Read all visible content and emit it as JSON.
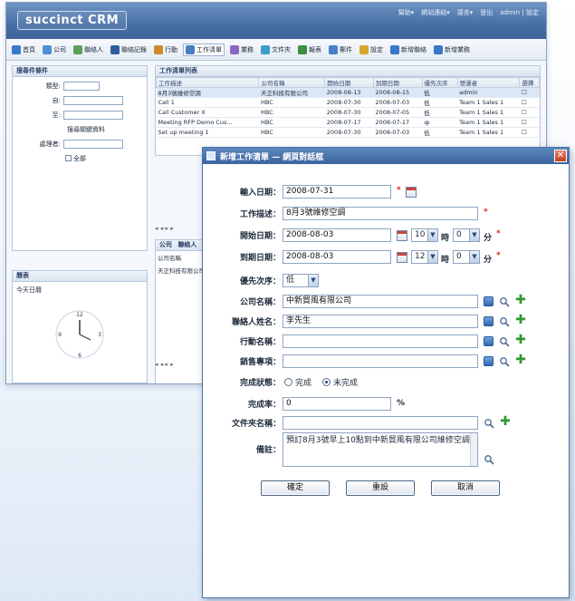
{
  "app": {
    "logo": "succinct CRM",
    "top_links": [
      "幫助▾",
      "網站連結▾",
      "語言▾",
      "登出",
      "admin | 設定"
    ]
  },
  "toolbar": {
    "items": [
      {
        "label": "首頁",
        "color": "#3a78c8"
      },
      {
        "label": "公司",
        "color": "#4f8fd4"
      },
      {
        "label": "聯絡人",
        "color": "#5aa05a"
      },
      {
        "label": "聯絡記錄",
        "color": "#2d5fa0"
      },
      {
        "label": "行動",
        "color": "#d08a2c"
      },
      {
        "label": "工作清單",
        "color": "#4a7fc0",
        "active": true
      },
      {
        "label": "業務",
        "color": "#8a6ac0"
      },
      {
        "label": "文件夾",
        "color": "#3aa0c8"
      },
      {
        "label": "報表",
        "color": "#3c8f3c"
      },
      {
        "label": "郵件",
        "color": "#4a80c8"
      },
      {
        "label": "設定",
        "color": "#d4a82c"
      },
      {
        "label": "新增聯絡",
        "color": "#3a78c8"
      },
      {
        "label": "新增業務",
        "color": "#3a78c8"
      }
    ]
  },
  "left_search": {
    "title": "搜尋件條件",
    "fields": [
      "類型:",
      "自:",
      "至:",
      "處理者:"
    ],
    "keyword_label": "搜尋關鍵資料",
    "checkbox_label": "全部"
  },
  "calendar_panel": {
    "title": "曆表",
    "today_label": "今天日曆"
  },
  "task_list": {
    "title": "工作清單列表",
    "columns": [
      "工作描述",
      "公司名稱",
      "開始日期",
      "到期日期",
      "優先次序",
      "營運者",
      "選擇"
    ],
    "rows": [
      {
        "cells": [
          "8月3號維修空調",
          "天正科技有限公司",
          "2008-08-13",
          "2008-08-15",
          "低",
          "admin",
          "☐"
        ],
        "selected": true
      },
      {
        "cells": [
          "Call 1",
          "HBC",
          "2008-07-30",
          "2008-07-03",
          "低",
          "Team 1 Sales 1",
          "☐"
        ],
        "selected": false
      },
      {
        "cells": [
          "Call Customer X",
          "HBC",
          "2008-07-30",
          "2008-07-05",
          "低",
          "Team 1 Sales 1",
          "☐"
        ],
        "selected": false
      },
      {
        "cells": [
          "Meeting RFP Demo Cus...",
          "HBC",
          "2008-07-17",
          "2008-07-17",
          "中",
          "Team 1 Sales 1",
          "☐"
        ],
        "selected": false
      },
      {
        "cells": [
          "Set up meeting 1",
          "HBC",
          "2008-07-30",
          "2008-07-03",
          "低",
          "Team 1 Sales 1",
          "☐"
        ],
        "selected": false
      }
    ],
    "pager": "◂ ◂ ▸ ▸"
  },
  "company_panel": {
    "tabs": [
      "公司",
      "聯絡人"
    ],
    "column": "公司名稱",
    "row": "天正科技有限公司",
    "pager": "◂ ◂ ▸ ▸"
  },
  "dialog": {
    "title": "新增工作清單 — 網頁對話框",
    "close": "✕",
    "fields": {
      "input_date": {
        "label": "輸入日期：",
        "value": "2008-07-31"
      },
      "work_desc": {
        "label": "工作描述：",
        "value": "8月3號維修空調"
      },
      "start_date": {
        "label": "開始日期：",
        "value": "2008-08-03",
        "hour": "10",
        "minute": "0"
      },
      "end_date": {
        "label": "到期日期：",
        "value": "2008-08-03",
        "hour": "12",
        "minute": "0"
      },
      "priority": {
        "label": "優先次序：",
        "value": "低"
      },
      "company": {
        "label": "公司名稱：",
        "value": "中新貿風有限公司"
      },
      "contact": {
        "label": "聯絡人姓名：",
        "value": "李先生"
      },
      "action": {
        "label": "行動名稱：",
        "value": ""
      },
      "sales_item": {
        "label": "銷售專項：",
        "value": ""
      },
      "status": {
        "label": "完成狀態：",
        "options": [
          "完成",
          "未完成"
        ],
        "selected": "未完成"
      },
      "completion": {
        "label": "完成率：",
        "value": "0",
        "unit": "%"
      },
      "folder": {
        "label": "文件夾名稱：",
        "value": ""
      },
      "remark": {
        "label": "備註：",
        "value": "預訂8月3號早上10點到中新貿風有限公司維修空調"
      }
    },
    "hour_unit": "時",
    "minute_unit": "分",
    "required_mark": "*",
    "buttons": {
      "confirm": "確定",
      "reset": "重設",
      "cancel": "取消"
    }
  }
}
